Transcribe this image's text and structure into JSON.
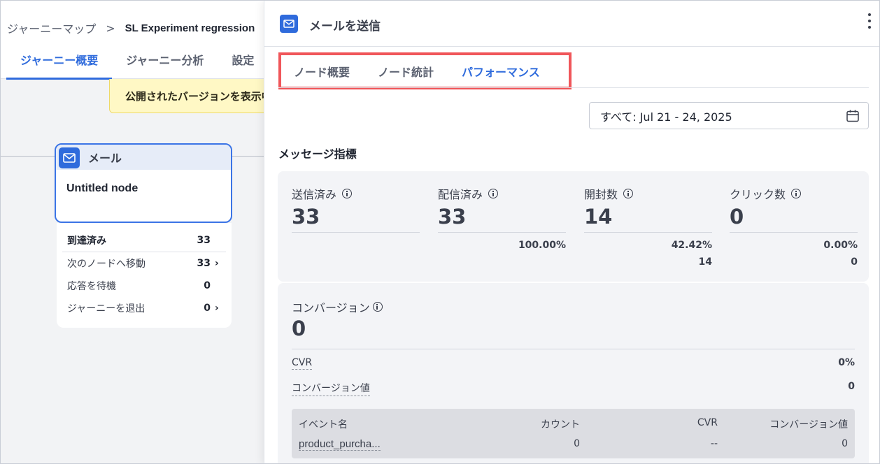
{
  "breadcrumb": {
    "parent": "ジャーニーマップ",
    "separator": ">",
    "current": "SL Experiment regression"
  },
  "left_tabs": [
    "ジャーニー概要",
    "ジャーニー分析",
    "設定"
  ],
  "banner": {
    "text": "公開されたバージョンを表示中"
  },
  "node": {
    "type_label": "メール",
    "title": "Untitled node",
    "stats": [
      {
        "label": "到達済み",
        "value": "33"
      },
      {
        "label": "次のノードへ移動",
        "value": "33"
      },
      {
        "label": "応答を待機",
        "value": "0"
      },
      {
        "label": "ジャーニーを退出",
        "value": "0"
      }
    ]
  },
  "panel": {
    "title": "メールを送信",
    "tabs": [
      "ノード概要",
      "ノード統計",
      "パフォーマンス"
    ],
    "active_tab": "パフォーマンス",
    "date_range": "すべて: Jul 21 - 24, 2025",
    "section_title": "メッセージ指標",
    "metrics": [
      {
        "label": "送信済み",
        "value": "33",
        "sub": "",
        "sub2": ""
      },
      {
        "label": "配信済み",
        "value": "33",
        "sub": "100.00%",
        "sub2": ""
      },
      {
        "label": "開封数",
        "value": "14",
        "sub": "42.42%",
        "sub2": "14"
      },
      {
        "label": "クリック数",
        "value": "0",
        "sub": "0.00%",
        "sub2": "0"
      }
    ],
    "conversion": {
      "label": "コンバージョン",
      "value": "0",
      "cvr_label": "CVR",
      "cvr_value": "0%",
      "value_label": "コンバージョン値",
      "value_value": "0"
    },
    "events_table": {
      "headers": [
        "イベント名",
        "カウント",
        "CVR",
        "コンバージョン値"
      ],
      "rows": [
        {
          "name": "product_purcha...",
          "count": "0",
          "cvr": "--",
          "value": "0"
        }
      ]
    }
  },
  "colors": {
    "accent": "#2f6bdc",
    "highlight_border": "#f0565a",
    "banner_bg": "#fff8c5"
  }
}
